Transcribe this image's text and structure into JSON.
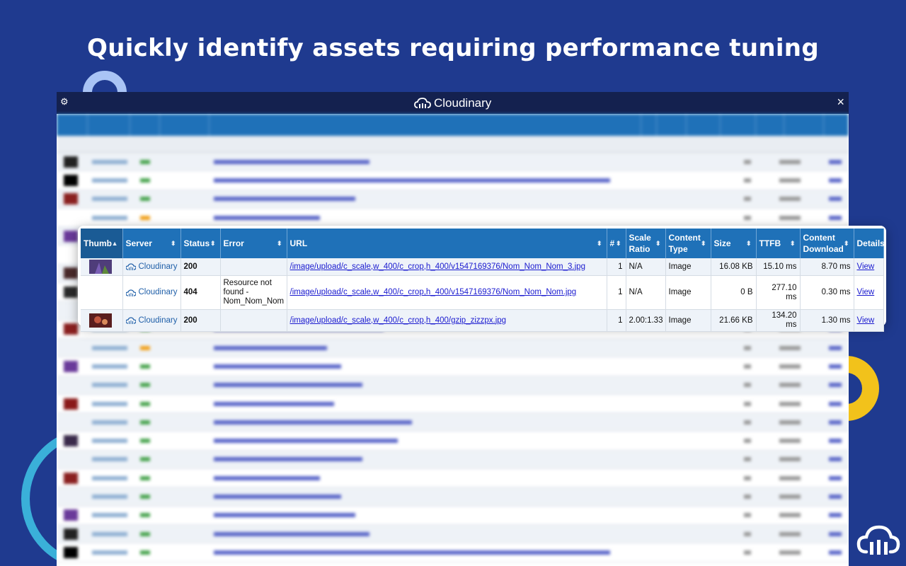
{
  "headline": "Quickly identify assets requiring performance tuning",
  "window": {
    "brand": "Cloudinary",
    "close_symbol": "×",
    "gear_symbol": "⚙"
  },
  "table": {
    "columns": [
      {
        "label": "Thumb",
        "sort": "▲"
      },
      {
        "label": "Server",
        "sort": "⬍"
      },
      {
        "label": "Status",
        "sort": "⬍"
      },
      {
        "label": "Error",
        "sort": "⬍"
      },
      {
        "label": "URL",
        "sort": "⬍"
      },
      {
        "label": "#",
        "sort": "⬍"
      },
      {
        "label": "Scale Ratio",
        "sort": "⬍"
      },
      {
        "label": "Content Type",
        "sort": "⬍"
      },
      {
        "label": "Size",
        "sort": "⬍"
      },
      {
        "label": "TTFB",
        "sort": "⬍"
      },
      {
        "label": "Content Download",
        "sort": "⬍"
      },
      {
        "label": "Details",
        "sort": ""
      }
    ],
    "rows": [
      {
        "thumb_color": "#5b3a8c",
        "server": "Cloudinary",
        "status": "200",
        "error": "",
        "url": "/image/upload/c_scale,w_400/c_crop,h_400/v1547169376/Nom_Nom_Nom_3.jpg",
        "count": "1",
        "scale_ratio": "N/A",
        "content_type": "Image",
        "size": "16.08 KB",
        "ttfb": "15.10 ms",
        "download": "8.70 ms",
        "details": "View"
      },
      {
        "thumb_color": "",
        "server": "Cloudinary",
        "status": "404",
        "error": "Resource not found - Nom_Nom_Nom",
        "url": "/image/upload/c_scale,w_400/c_crop,h_400/v1547169376/Nom_Nom_Nom.jpg",
        "count": "1",
        "scale_ratio": "N/A",
        "content_type": "Image",
        "size": "0 B",
        "ttfb": "277.10 ms",
        "download": "0.30 ms",
        "details": "View"
      },
      {
        "thumb_color": "#8c2a2a",
        "server": "Cloudinary",
        "status": "200",
        "error": "",
        "url": "/image/upload/c_scale,w_400/c_crop,h_400/gzip_zizzpx.jpg",
        "count": "1",
        "scale_ratio": "2.00:1.33",
        "content_type": "Image",
        "size": "21.66 KB",
        "ttfb": "134.20 ms",
        "download": "1.30 ms",
        "details": "View"
      }
    ]
  },
  "colors": {
    "background": "#1f3a8f",
    "header": "#1f71b8",
    "status_ok": "#1f8a1f",
    "status_warn": "#f2a11a",
    "error": "#e01b1b",
    "link": "#1a1acf"
  },
  "icons": [
    "gear-icon",
    "cloudinary-logo-icon",
    "close-icon",
    "sort-icon",
    "cloud-icon"
  ]
}
